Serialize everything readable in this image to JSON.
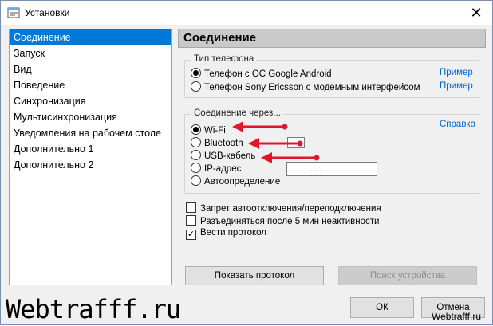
{
  "window": {
    "title": "Установки",
    "close_glyph": "✕",
    "icon": "settings-app-icon"
  },
  "nav": {
    "items": [
      {
        "label": "Соединение",
        "selected": true
      },
      {
        "label": "Запуск",
        "selected": false
      },
      {
        "label": "Вид",
        "selected": false
      },
      {
        "label": "Поведение",
        "selected": false
      },
      {
        "label": "Синхронизация",
        "selected": false
      },
      {
        "label": "Мультисинхронизация",
        "selected": false
      },
      {
        "label": "Уведомления на рабочем столе",
        "selected": false
      },
      {
        "label": "Дополнительно 1",
        "selected": false
      },
      {
        "label": "Дополнительно 2",
        "selected": false
      }
    ]
  },
  "panel": {
    "header": "Соединение",
    "phone_type": {
      "title": "Тип телефона",
      "options": [
        {
          "label": "Телефон с ОС Google Android",
          "checked": true,
          "link": "Пример"
        },
        {
          "label": "Телефон Sony Ericsson с модемным интерфейсом",
          "checked": false,
          "link": "Пример"
        }
      ]
    },
    "connection": {
      "title": "Соединение через...",
      "help_link": "Справка",
      "options": [
        {
          "label": "Wi-Fi",
          "checked": true
        },
        {
          "label": "Bluetooth",
          "checked": false
        },
        {
          "label": "USB-кабель",
          "checked": false
        },
        {
          "label": "IP-адрес",
          "checked": false
        },
        {
          "label": "Автоопределение",
          "checked": false
        }
      ],
      "ip_placeholder": ".   .   ."
    },
    "checkboxes": [
      {
        "label": "Запрет автоотключения/переподключения",
        "checked": false
      },
      {
        "label": "Разъединяться после 5 мин неактивности",
        "checked": false
      },
      {
        "label": "Вести протокол",
        "checked": true
      }
    ],
    "show_log_button": "Показать протокол",
    "device_search_button": "Поиск устройства"
  },
  "footer": {
    "ok_button": "ОК",
    "cancel_button": "Отмена"
  },
  "watermark": {
    "big": "Webtrafff.ru",
    "small": "Webtrafff.ru"
  },
  "colors": {
    "selection": "#0078d7",
    "link": "#0066cc",
    "annotation_arrow": "#e0162b"
  }
}
